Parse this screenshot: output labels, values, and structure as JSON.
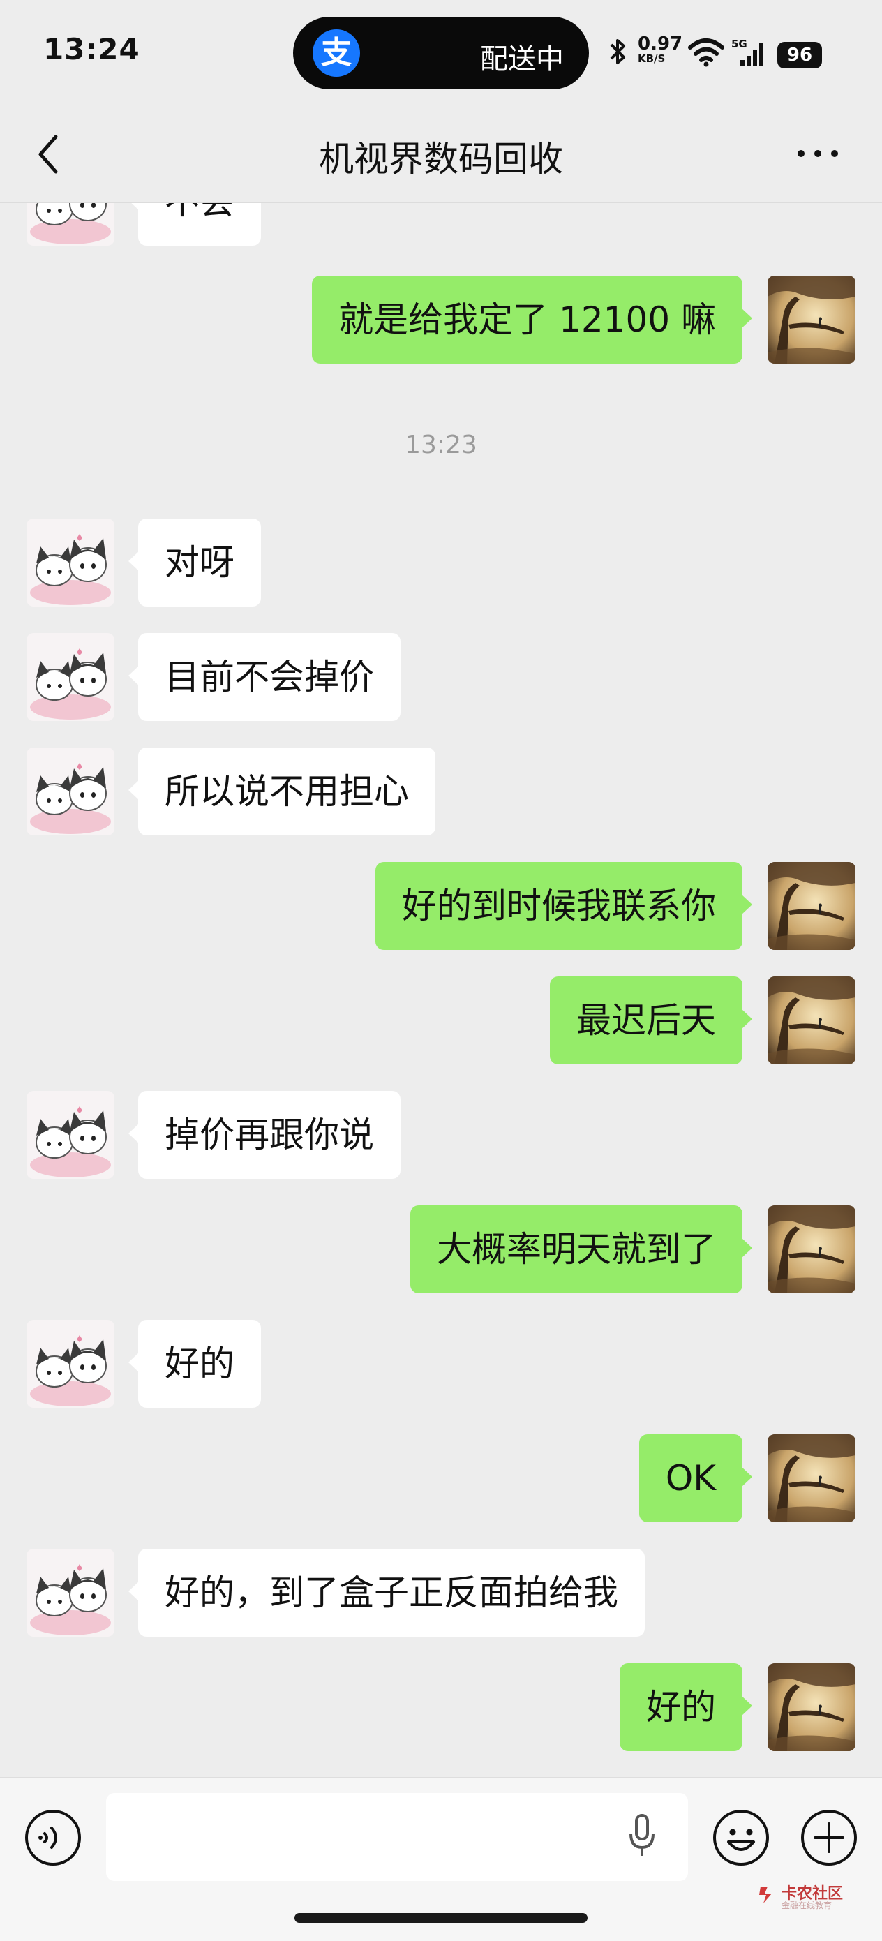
{
  "status_bar": {
    "time": "13:24",
    "island_text": "配送中",
    "island_app_icon": "alipay-icon",
    "alipay_glyph": "支",
    "net_speed": "0.97",
    "net_speed_unit": "KB/S",
    "network": "5G",
    "battery": "96"
  },
  "nav": {
    "title": "机视界数码回收",
    "back_icon": "chevron-left-icon",
    "more_icon": "more-dots-icon"
  },
  "colors": {
    "background": "#ededed",
    "bubble_self": "#95ec69",
    "bubble_other": "#ffffff"
  },
  "chat": {
    "partial_message": "不会",
    "timestamp": "13:23",
    "messages": [
      {
        "side": "right",
        "text": "就是给我定了 12100 嘛"
      },
      {
        "side": "left",
        "text": "对呀"
      },
      {
        "side": "left",
        "text": "目前不会掉价"
      },
      {
        "side": "left",
        "text": "所以说不用担心"
      },
      {
        "side": "right",
        "text": "好的到时候我联系你"
      },
      {
        "side": "right",
        "text": "最迟后天"
      },
      {
        "side": "left",
        "text": "掉价再跟你说"
      },
      {
        "side": "right",
        "text": "大概率明天就到了"
      },
      {
        "side": "left",
        "text": "好的"
      },
      {
        "side": "right",
        "text": "OK"
      },
      {
        "side": "left",
        "text": "好的，到了盒子正反面拍给我"
      },
      {
        "side": "right",
        "text": "好的"
      }
    ]
  },
  "input_bar": {
    "voice_icon": "voice-icon",
    "mic_icon": "mic-icon",
    "emoji_icon": "emoji-icon",
    "plus_icon": "plus-icon",
    "input_value": ""
  },
  "watermark": {
    "text": "卡农社区",
    "subtext": "金融在线教育"
  }
}
